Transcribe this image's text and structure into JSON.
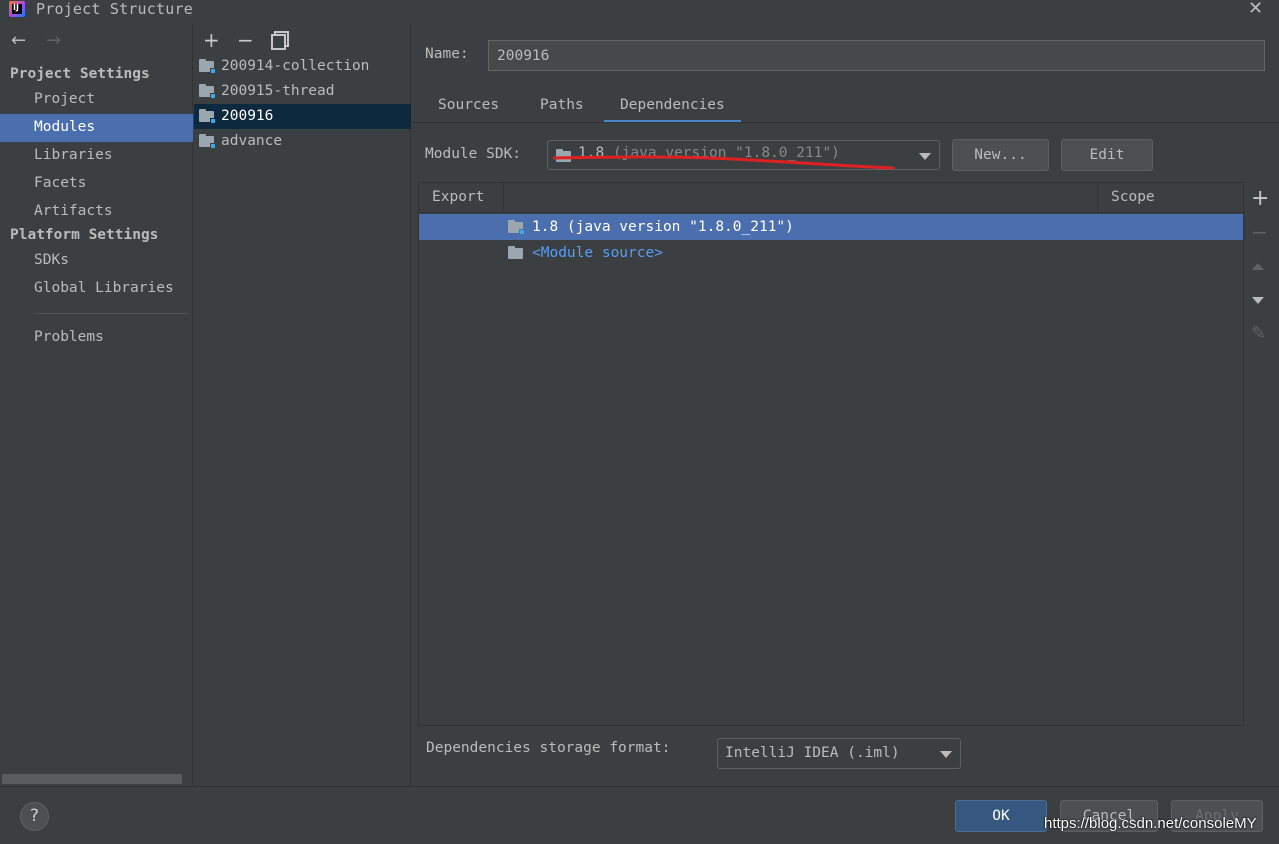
{
  "window": {
    "title": "Project Structure",
    "close_symbol": "✕",
    "logo_text": "IJ"
  },
  "nav": {
    "back_symbol": "←",
    "forward_symbol": "→",
    "project_settings_heading": "Project Settings",
    "project_settings_items": [
      "Project",
      "Modules",
      "Libraries",
      "Facets",
      "Artifacts"
    ],
    "platform_settings_heading": "Platform Settings",
    "platform_settings_items": [
      "SDKs",
      "Global Libraries"
    ],
    "problems": "Problems",
    "selected": "Modules"
  },
  "modules": {
    "add_symbol": "+",
    "remove_symbol": "−",
    "items": [
      "200914-collection",
      "200915-thread",
      "200916",
      "advance"
    ],
    "selected": "200916"
  },
  "detail": {
    "name_label": "Name:",
    "name_value": "200916",
    "tabs": [
      "Sources",
      "Paths",
      "Dependencies"
    ],
    "active_tab": "Dependencies",
    "sdk_label": "Module SDK:",
    "sdk_version": "1.8",
    "sdk_detail": "(java version \"1.8.0_211\")",
    "new_button": "New...",
    "edit_button": "Edit"
  },
  "dependencies": {
    "columns": [
      "Export",
      "Scope"
    ],
    "rows": [
      {
        "label": "1.8 (java version \"1.8.0_211\")",
        "selected": true
      },
      {
        "label": "<Module source>",
        "selected": false
      }
    ],
    "add_symbol": "+",
    "remove_symbol": "−",
    "edit_symbol": "✎"
  },
  "storage": {
    "label": "Dependencies storage format:",
    "value": "IntelliJ IDEA (.iml)"
  },
  "footer": {
    "help_symbol": "?",
    "ok": "OK",
    "cancel": "Cancel",
    "apply": "Apply",
    "watermark": "https://blog.csdn.net/consoleMY"
  },
  "colors": {
    "selection": "#4b6eaf",
    "background": "#3c3f41",
    "link": "#589df6",
    "annotation": "#e02020"
  }
}
